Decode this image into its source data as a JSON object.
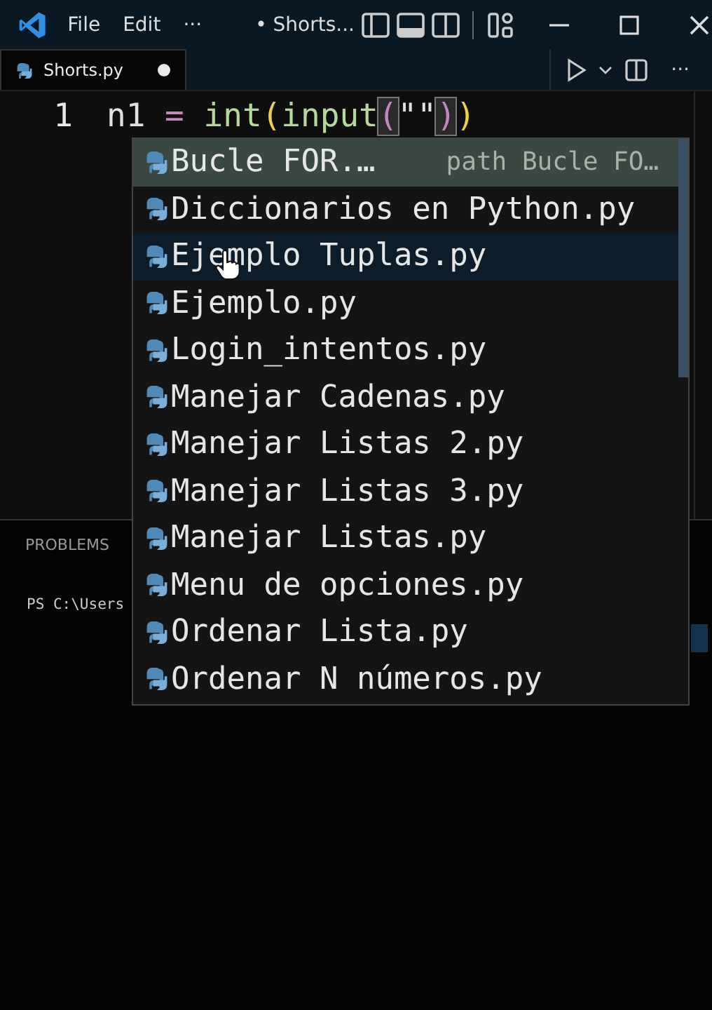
{
  "title_bar": {
    "menu": [
      "File",
      "Edit",
      "···"
    ],
    "title": "• Shorts..."
  },
  "tabs": [
    {
      "label": "Shorts.py",
      "selected": true,
      "modified": true
    }
  ],
  "editor_actions": {
    "more": "···"
  },
  "editor": {
    "lines": [
      {
        "number": "1",
        "tokens": [
          {
            "text": "n1",
            "kind": "plain",
            "matched": false
          },
          {
            "text": "=",
            "kind": "operator",
            "matched": false
          },
          {
            "text": "int",
            "kind": "function",
            "matched": false
          },
          {
            "text": "(",
            "kind": "bracket1",
            "matched": false
          },
          {
            "text": "input",
            "kind": "function",
            "matched": false
          },
          {
            "text": "(",
            "kind": "bracket2",
            "matched": true
          },
          {
            "text": "\"\"",
            "kind": "plain",
            "matched": false
          },
          {
            "text": ")",
            "kind": "bracket2",
            "matched": true
          },
          {
            "text": ")",
            "kind": "bracket1",
            "matched": false
          }
        ]
      }
    ]
  },
  "suggestions": [
    {
      "label": "Bucle FOR.…",
      "detail": "path Bucle FO…",
      "selected": true,
      "hovered": false
    },
    {
      "label": "Diccionarios en Python.py",
      "selected": false,
      "hovered": false
    },
    {
      "label": "Ejemplo Tuplas.py",
      "selected": false,
      "hovered": true
    },
    {
      "label": "Ejemplo.py",
      "selected": false,
      "hovered": false
    },
    {
      "label": "Login_intentos.py",
      "selected": false,
      "hovered": false
    },
    {
      "label": "Manejar Cadenas.py",
      "selected": false,
      "hovered": false
    },
    {
      "label": "Manejar Listas 2.py",
      "selected": false,
      "hovered": false
    },
    {
      "label": "Manejar Listas 3.py",
      "selected": false,
      "hovered": false
    },
    {
      "label": "Manejar Listas.py",
      "selected": false,
      "hovered": false
    },
    {
      "label": "Menu de opciones.py",
      "selected": false,
      "hovered": false
    },
    {
      "label": "Ordenar Lista.py",
      "selected": false,
      "hovered": false
    },
    {
      "label": "Ordenar N números.py",
      "selected": false,
      "hovered": false
    }
  ],
  "panel": {
    "tabs": [
      {
        "label": "PROBLEMS",
        "selected": false
      }
    ],
    "terminal": "PS C:\\Users"
  }
}
